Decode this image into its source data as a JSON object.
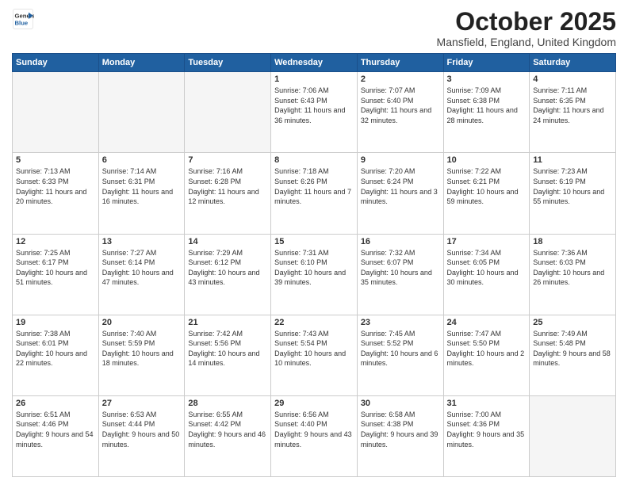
{
  "header": {
    "logo_general": "General",
    "logo_blue": "Blue",
    "month_title": "October 2025",
    "location": "Mansfield, England, United Kingdom"
  },
  "days_of_week": [
    "Sunday",
    "Monday",
    "Tuesday",
    "Wednesday",
    "Thursday",
    "Friday",
    "Saturday"
  ],
  "weeks": [
    [
      {
        "day": "",
        "empty": true
      },
      {
        "day": "",
        "empty": true
      },
      {
        "day": "",
        "empty": true
      },
      {
        "day": "1",
        "sunrise": "7:06 AM",
        "sunset": "6:43 PM",
        "daylight": "11 hours and 36 minutes."
      },
      {
        "day": "2",
        "sunrise": "7:07 AM",
        "sunset": "6:40 PM",
        "daylight": "11 hours and 32 minutes."
      },
      {
        "day": "3",
        "sunrise": "7:09 AM",
        "sunset": "6:38 PM",
        "daylight": "11 hours and 28 minutes."
      },
      {
        "day": "4",
        "sunrise": "7:11 AM",
        "sunset": "6:35 PM",
        "daylight": "11 hours and 24 minutes."
      }
    ],
    [
      {
        "day": "5",
        "sunrise": "7:13 AM",
        "sunset": "6:33 PM",
        "daylight": "11 hours and 20 minutes."
      },
      {
        "day": "6",
        "sunrise": "7:14 AM",
        "sunset": "6:31 PM",
        "daylight": "11 hours and 16 minutes."
      },
      {
        "day": "7",
        "sunrise": "7:16 AM",
        "sunset": "6:28 PM",
        "daylight": "11 hours and 12 minutes."
      },
      {
        "day": "8",
        "sunrise": "7:18 AM",
        "sunset": "6:26 PM",
        "daylight": "11 hours and 7 minutes."
      },
      {
        "day": "9",
        "sunrise": "7:20 AM",
        "sunset": "6:24 PM",
        "daylight": "11 hours and 3 minutes."
      },
      {
        "day": "10",
        "sunrise": "7:22 AM",
        "sunset": "6:21 PM",
        "daylight": "10 hours and 59 minutes."
      },
      {
        "day": "11",
        "sunrise": "7:23 AM",
        "sunset": "6:19 PM",
        "daylight": "10 hours and 55 minutes."
      }
    ],
    [
      {
        "day": "12",
        "sunrise": "7:25 AM",
        "sunset": "6:17 PM",
        "daylight": "10 hours and 51 minutes."
      },
      {
        "day": "13",
        "sunrise": "7:27 AM",
        "sunset": "6:14 PM",
        "daylight": "10 hours and 47 minutes."
      },
      {
        "day": "14",
        "sunrise": "7:29 AM",
        "sunset": "6:12 PM",
        "daylight": "10 hours and 43 minutes."
      },
      {
        "day": "15",
        "sunrise": "7:31 AM",
        "sunset": "6:10 PM",
        "daylight": "10 hours and 39 minutes."
      },
      {
        "day": "16",
        "sunrise": "7:32 AM",
        "sunset": "6:07 PM",
        "daylight": "10 hours and 35 minutes."
      },
      {
        "day": "17",
        "sunrise": "7:34 AM",
        "sunset": "6:05 PM",
        "daylight": "10 hours and 30 minutes."
      },
      {
        "day": "18",
        "sunrise": "7:36 AM",
        "sunset": "6:03 PM",
        "daylight": "10 hours and 26 minutes."
      }
    ],
    [
      {
        "day": "19",
        "sunrise": "7:38 AM",
        "sunset": "6:01 PM",
        "daylight": "10 hours and 22 minutes."
      },
      {
        "day": "20",
        "sunrise": "7:40 AM",
        "sunset": "5:59 PM",
        "daylight": "10 hours and 18 minutes."
      },
      {
        "day": "21",
        "sunrise": "7:42 AM",
        "sunset": "5:56 PM",
        "daylight": "10 hours and 14 minutes."
      },
      {
        "day": "22",
        "sunrise": "7:43 AM",
        "sunset": "5:54 PM",
        "daylight": "10 hours and 10 minutes."
      },
      {
        "day": "23",
        "sunrise": "7:45 AM",
        "sunset": "5:52 PM",
        "daylight": "10 hours and 6 minutes."
      },
      {
        "day": "24",
        "sunrise": "7:47 AM",
        "sunset": "5:50 PM",
        "daylight": "10 hours and 2 minutes."
      },
      {
        "day": "25",
        "sunrise": "7:49 AM",
        "sunset": "5:48 PM",
        "daylight": "9 hours and 58 minutes."
      }
    ],
    [
      {
        "day": "26",
        "sunrise": "6:51 AM",
        "sunset": "4:46 PM",
        "daylight": "9 hours and 54 minutes."
      },
      {
        "day": "27",
        "sunrise": "6:53 AM",
        "sunset": "4:44 PM",
        "daylight": "9 hours and 50 minutes."
      },
      {
        "day": "28",
        "sunrise": "6:55 AM",
        "sunset": "4:42 PM",
        "daylight": "9 hours and 46 minutes."
      },
      {
        "day": "29",
        "sunrise": "6:56 AM",
        "sunset": "4:40 PM",
        "daylight": "9 hours and 43 minutes."
      },
      {
        "day": "30",
        "sunrise": "6:58 AM",
        "sunset": "4:38 PM",
        "daylight": "9 hours and 39 minutes."
      },
      {
        "day": "31",
        "sunrise": "7:00 AM",
        "sunset": "4:36 PM",
        "daylight": "9 hours and 35 minutes."
      },
      {
        "day": "",
        "empty": true
      }
    ]
  ]
}
